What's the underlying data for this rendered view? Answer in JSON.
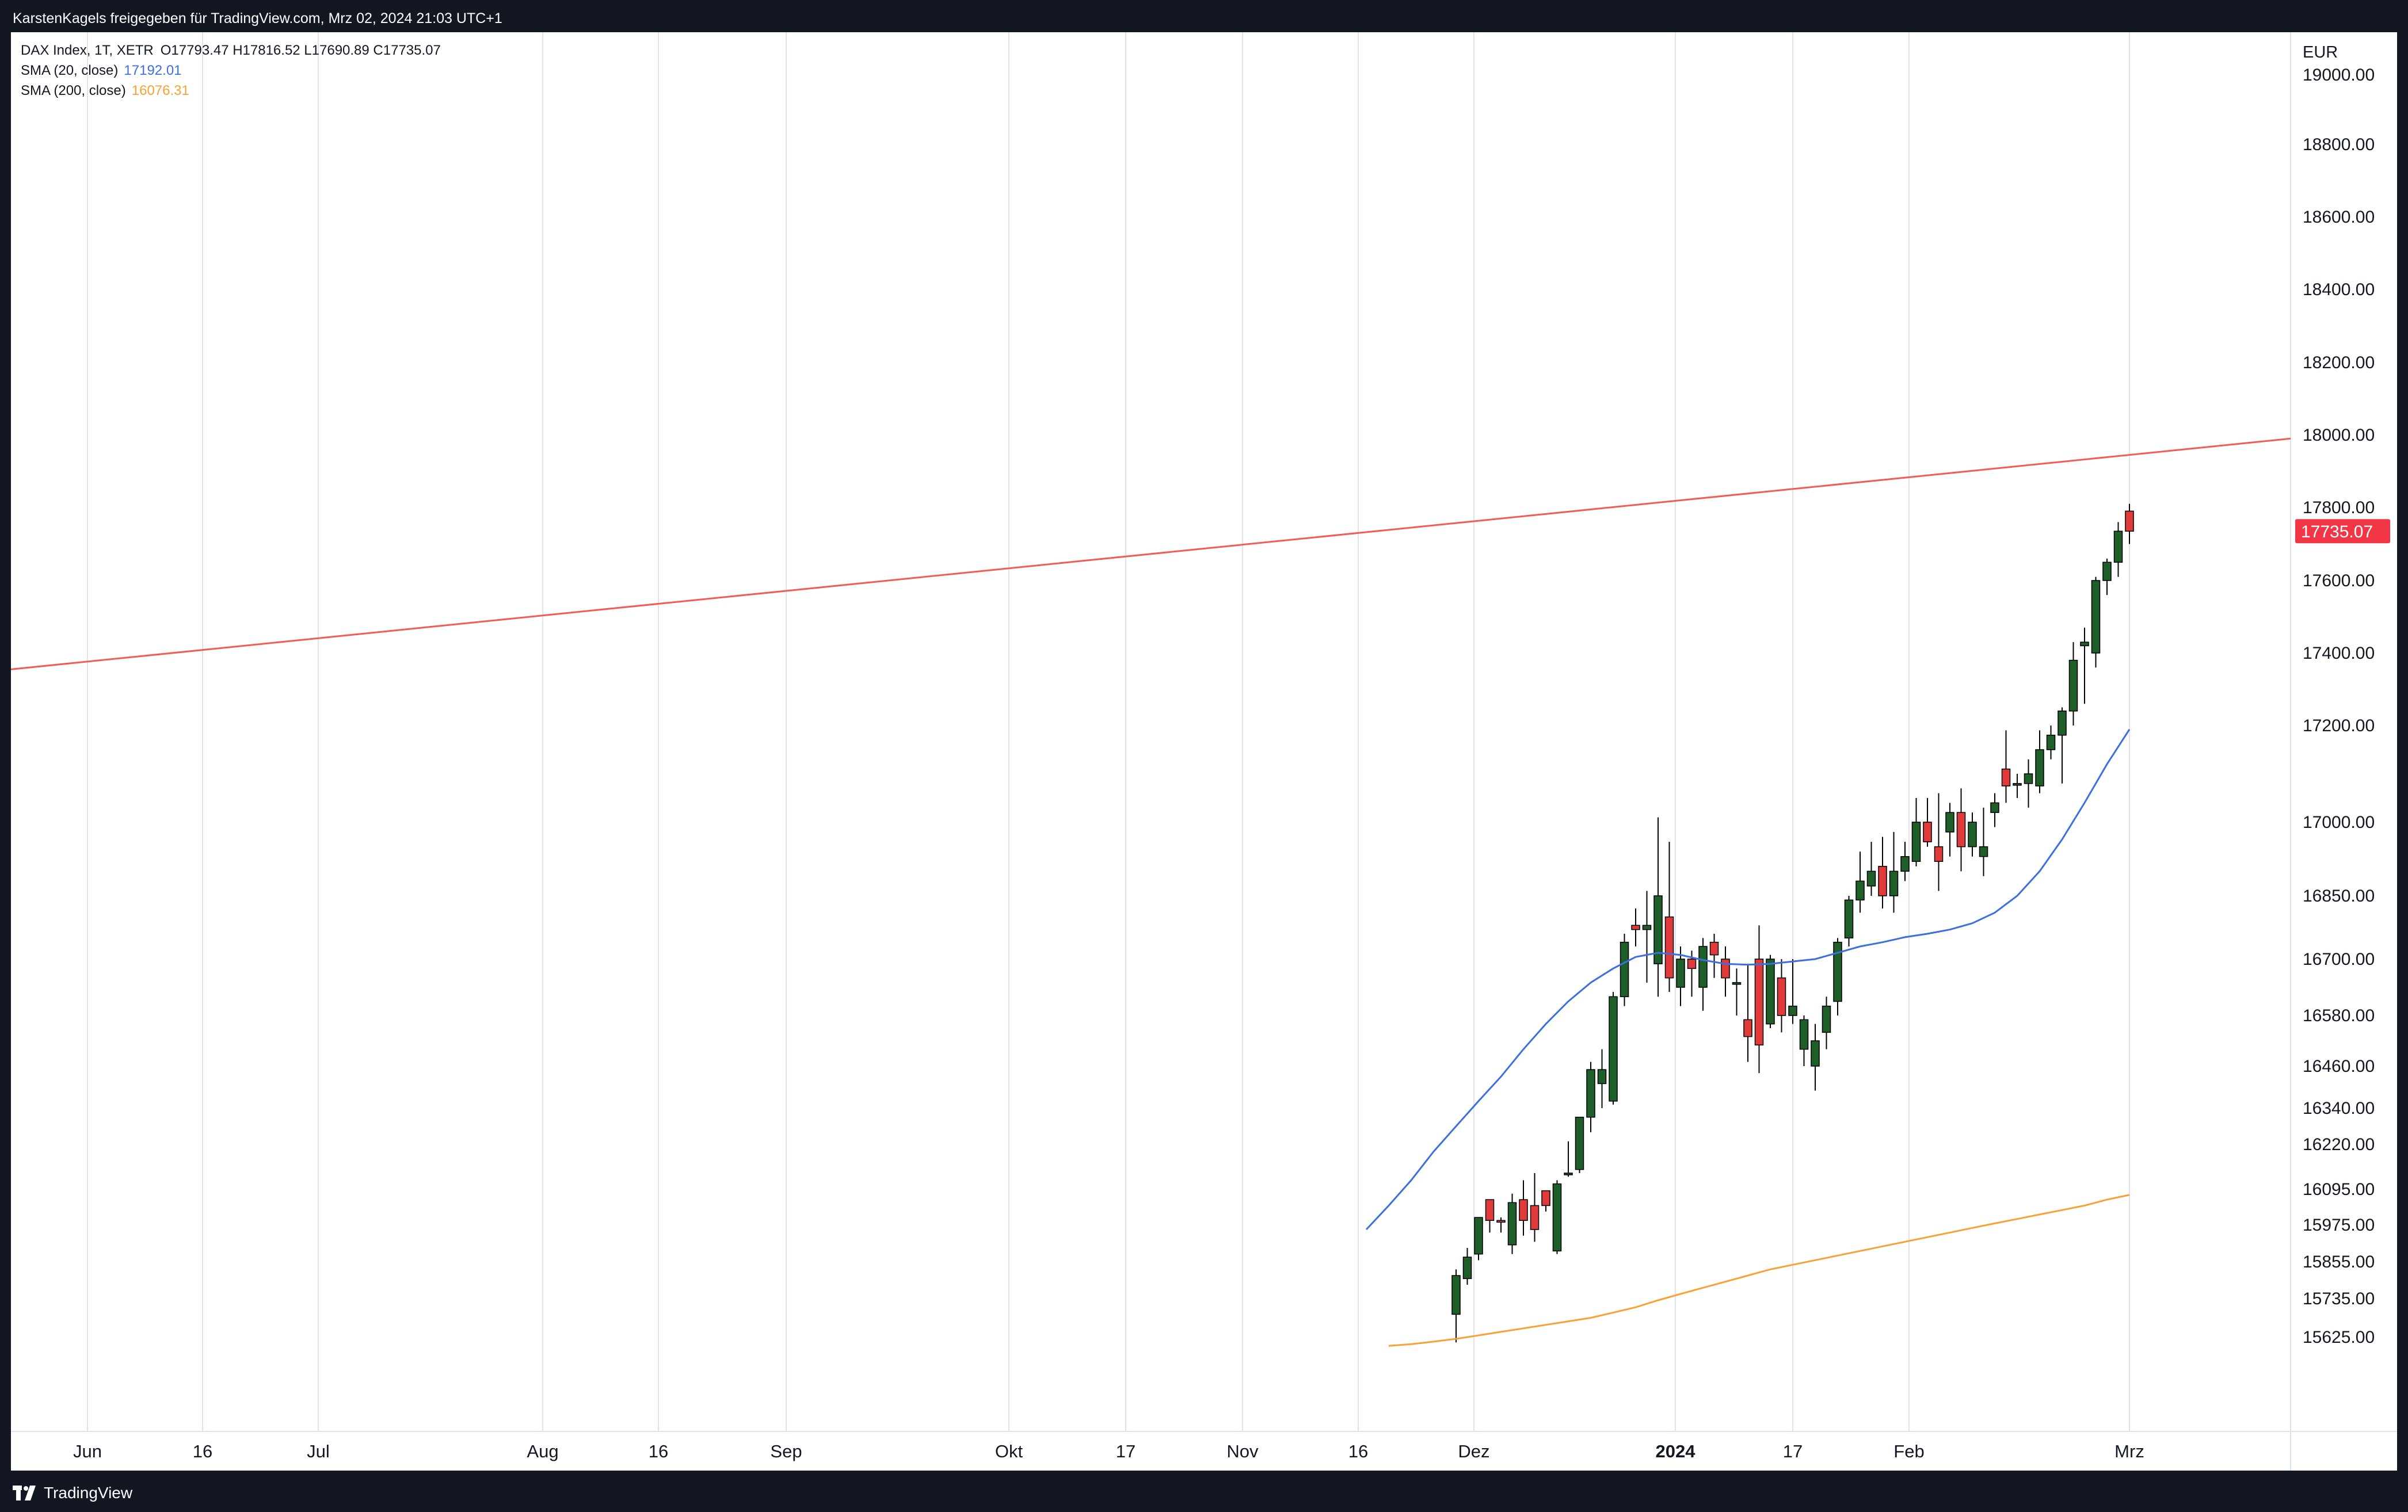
{
  "header": {
    "attribution": "KarstenKagels freigegeben für TradingView.com, Mrz 02, 2024 21:03 UTC+1"
  },
  "legend": {
    "symbol": "DAX Index, 1T, XETR",
    "ohlc": "O17793.47  H17816.52  L17690.89  C17735.07",
    "sma20_label": "SMA (20, close)",
    "sma20_value": "17192.01",
    "sma200_label": "SMA (200, close)",
    "sma200_value": "16076.31"
  },
  "footer": {
    "brand": "TradingView"
  },
  "colors": {
    "up": "#1e5e28",
    "down": "#e03a3a",
    "sma20": "#3d6fe0",
    "sma200": "#f7a234",
    "trendline": "#f25c54",
    "grid": "#e0e3eb",
    "price_tag": "#f23645"
  },
  "chart_data": {
    "type": "candlestick",
    "currency": "EUR",
    "last_price_label": "17735.07",
    "y_ticks": [
      "19000.00",
      "18800.00",
      "18600.00",
      "18400.00",
      "18200.00",
      "18000.00",
      "17800.00",
      "17600.00",
      "17400.00",
      "17200.00",
      "17000.00",
      "16850.00",
      "16700.00",
      "16580.00",
      "16460.00",
      "16340.00",
      "16220.00",
      "16095.00",
      "15975.00",
      "15855.00",
      "15735.00",
      "15625.00"
    ],
    "x_labels": [
      "Jun",
      "16",
      "Jul",
      "Aug",
      "16",
      "Sep",
      "Okt",
      "17",
      "Nov",
      "16",
      "Dez",
      "2024",
      "17",
      "Feb",
      "Mrz"
    ],
    "x_label_bold": "2024",
    "trendline": {
      "start_price": 17355,
      "end_price": 17990
    },
    "candles_up_color": "green",
    "candles": [
      [
        17790,
        17810,
        17700,
        17735
      ],
      [
        17650,
        17760,
        17610,
        17735
      ],
      [
        17600,
        17660,
        17560,
        17650
      ],
      [
        17400,
        17610,
        17360,
        17600
      ],
      [
        17420,
        17470,
        17260,
        17430
      ],
      [
        17240,
        17430,
        17200,
        17380
      ],
      [
        17180,
        17250,
        17080,
        17240
      ],
      [
        17150,
        17200,
        17130,
        17180
      ],
      [
        17075,
        17190,
        17060,
        17150
      ],
      [
        17080,
        17130,
        17030,
        17100
      ],
      [
        17080,
        17100,
        17050,
        17080
      ],
      [
        17110,
        17190,
        17040,
        17075
      ],
      [
        17020,
        17060,
        16990,
        17040
      ],
      [
        16930,
        17030,
        16890,
        16950
      ],
      [
        16950,
        17020,
        16930,
        17000
      ],
      [
        17020,
        17070,
        16900,
        16950
      ],
      [
        16980,
        17040,
        16930,
        17020
      ],
      [
        16950,
        17060,
        16860,
        16920
      ],
      [
        17000,
        17050,
        16950,
        16960
      ],
      [
        16920,
        17050,
        16910,
        17000
      ],
      [
        16900,
        16960,
        16880,
        16930
      ],
      [
        16850,
        16980,
        16810,
        16900
      ],
      [
        16910,
        16970,
        16820,
        16850
      ],
      [
        16870,
        16960,
        16850,
        16900
      ],
      [
        16840,
        16940,
        16810,
        16880
      ],
      [
        16750,
        16850,
        16730,
        16840
      ],
      [
        16610,
        16750,
        16580,
        16740
      ],
      [
        16540,
        16620,
        16500,
        16600
      ],
      [
        16460,
        16560,
        16390,
        16520
      ],
      [
        16500,
        16580,
        16460,
        16570
      ],
      [
        16580,
        16700,
        16560,
        16600
      ],
      [
        16660,
        16700,
        16540,
        16580
      ],
      [
        16560,
        16710,
        16550,
        16700
      ],
      [
        16700,
        16780,
        16440,
        16510
      ],
      [
        16570,
        16690,
        16470,
        16530
      ],
      [
        16650,
        16680,
        16580,
        16650
      ],
      [
        16700,
        16730,
        16620,
        16660
      ],
      [
        16740,
        16760,
        16660,
        16710
      ],
      [
        16640,
        16750,
        16590,
        16730
      ],
      [
        16700,
        16720,
        16620,
        16680
      ],
      [
        16640,
        16730,
        16600,
        16700
      ],
      [
        16800,
        16960,
        16630,
        16660
      ],
      [
        16690,
        17010,
        16620,
        16850
      ],
      [
        16770,
        16860,
        16650,
        16780
      ],
      [
        16780,
        16820,
        16730,
        16770
      ],
      [
        16620,
        16760,
        16600,
        16740
      ],
      [
        16360,
        16630,
        16350,
        16620
      ],
      [
        16410,
        16500,
        16340,
        16450
      ],
      [
        16310,
        16470,
        16260,
        16450
      ],
      [
        16150,
        16310,
        16140,
        16310
      ],
      [
        16140,
        16230,
        16130,
        16140
      ],
      [
        15890,
        16120,
        15880,
        16110
      ],
      [
        16090,
        16080,
        16020,
        16040
      ],
      [
        16040,
        16140,
        15920,
        15960
      ],
      [
        16060,
        16120,
        15940,
        15990
      ],
      [
        15910,
        16080,
        15880,
        16050
      ],
      [
        15990,
        16000,
        15950,
        15985
      ],
      [
        16060,
        16030,
        15950,
        15990
      ],
      [
        15880,
        16000,
        15860,
        16000
      ],
      [
        15800,
        15900,
        15780,
        15870
      ],
      [
        15690,
        15830,
        15610,
        15810
      ]
    ],
    "sma20": [
      17192,
      17120,
      17040,
      16965,
      16900,
      16850,
      16810,
      16785,
      16770,
      16760,
      16752,
      16740,
      16730,
      16715,
      16700,
      16695,
      16690,
      16688,
      16690,
      16698,
      16710,
      16715,
      16705,
      16680,
      16650,
      16610,
      16560,
      16500,
      16430,
      16360,
      16280,
      16200,
      16120,
      16040,
      15960
    ],
    "sma200": [
      16076,
      16060,
      16040,
      16025,
      16010,
      15995,
      15980,
      15965,
      15950,
      15935,
      15920,
      15905,
      15890,
      15875,
      15860,
      15845,
      15830,
      15810,
      15790,
      15770,
      15750,
      15730,
      15710,
      15695,
      15680,
      15670,
      15660,
      15650,
      15640,
      15630,
      15620,
      15612,
      15605,
      15600
    ]
  }
}
